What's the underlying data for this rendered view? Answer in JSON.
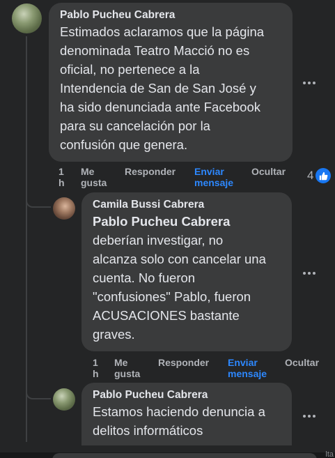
{
  "comments": [
    {
      "author": "Pablo Pucheu Cabrera",
      "text": "Estimados aclaramos que la página\ndenominada Teatro Macció no es\noficial, no pertenece a la\nIntendencia de San de San José y\nha sido denunciada ante Facebook\npara su cancelación por la\nconfusión que genera.",
      "time": "1 h",
      "like": "Me gusta",
      "reply": "Responder",
      "message": "Enviar mensaje",
      "hide": "Ocultar",
      "reactions": "4"
    },
    {
      "author": "Camila Bussi Cabrera",
      "mention": "Pablo Pucheu Cabrera",
      "text": "deberían investigar, no\nalcanza solo con cancelar una\ncuenta. No fueron\n\"confusiones\" Pablo, fueron\nACUSACIONES bastante\ngraves.",
      "time": "1 h",
      "like": "Me gusta",
      "reply": "Responder",
      "message": "Enviar mensaje",
      "hide": "Ocultar"
    },
    {
      "author": "Pablo Pucheu Cabrera",
      "text": "Estamos haciendo denuncia a\ndelitos informáticos"
    }
  ],
  "edge_text": "lta",
  "colors": {
    "bubble": "#3a3b3c",
    "link": "#2d88ff",
    "like": "#1877f2"
  }
}
